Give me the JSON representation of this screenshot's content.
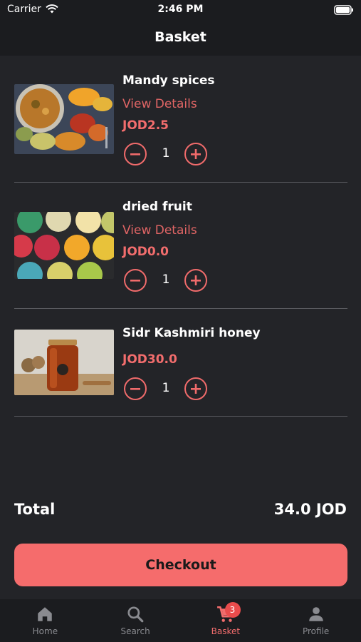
{
  "status_bar": {
    "carrier": "Carrier",
    "time": "2:46 PM"
  },
  "nav": {
    "title": "Basket"
  },
  "items": [
    {
      "name": "Mandy spices",
      "details": "View Details",
      "price": "JOD2.5",
      "qty": "1"
    },
    {
      "name": "dried fruit",
      "details": "View Details",
      "price": "JOD0.0",
      "qty": "1"
    },
    {
      "name": "Sidr Kashmiri honey",
      "price": "JOD30.0",
      "qty": "1"
    }
  ],
  "summary": {
    "total_label": "Total",
    "total_value": "34.0 JOD"
  },
  "checkout": {
    "label": "Checkout"
  },
  "tabs": [
    {
      "label": "Home",
      "icon": "home-icon"
    },
    {
      "label": "Search",
      "icon": "search-icon"
    },
    {
      "label": "Basket",
      "icon": "cart-icon",
      "badge": "3",
      "active": true
    },
    {
      "label": "Profile",
      "icon": "person-icon"
    }
  ],
  "colors": {
    "accent": "#f56c6c",
    "background": "#232428",
    "bar": "#1b1c1f",
    "divider": "#5a5b60"
  }
}
